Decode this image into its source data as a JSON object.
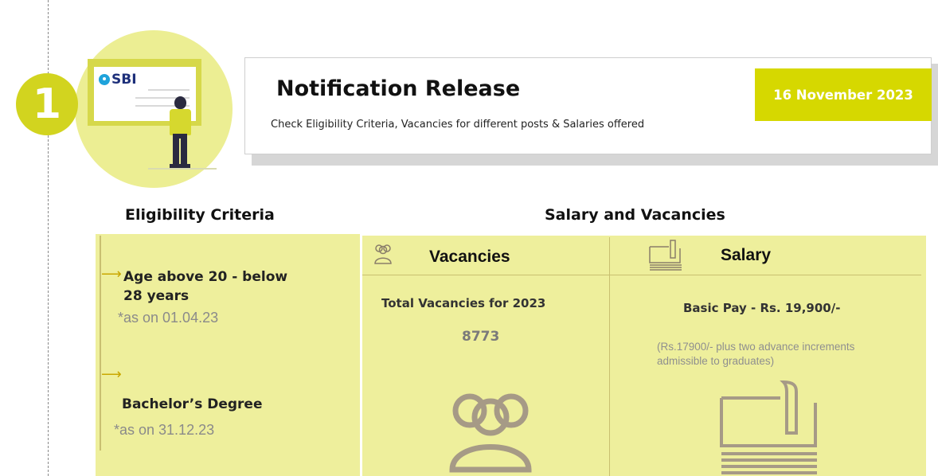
{
  "step": {
    "number": "1"
  },
  "logo": {
    "text": "SBI"
  },
  "notification": {
    "title": "Notification Release",
    "description": "Check Eligibility Criteria, Vacancies for different posts & Salaries offered",
    "date": "16 November 2023"
  },
  "eligibility": {
    "heading": "Eligibility Criteria",
    "items": [
      {
        "label_line1": "Age above 20 - below",
        "label_line2": "28 years",
        "note": "*as on 01.04.23"
      },
      {
        "label": "Bachelor’s Degree",
        "note": "*as on 31.12.23"
      }
    ]
  },
  "salary_vacancies": {
    "heading": "Salary and Vacancies",
    "vacancies": {
      "title": "Vacancies",
      "subtitle": "Total  Vacancies for 2023",
      "value": "8773",
      "icon": "people-group-icon"
    },
    "salary": {
      "title": "Salary",
      "basic_pay": "Basic Pay - Rs. 19,900/-",
      "note": "(Rs.17900/- plus two advance increments admissible to graduates)",
      "icon": "document-stack-icon"
    }
  },
  "colors": {
    "accent": "#d6d800",
    "panel": "#eeef9c",
    "circle": "#ecee93"
  }
}
